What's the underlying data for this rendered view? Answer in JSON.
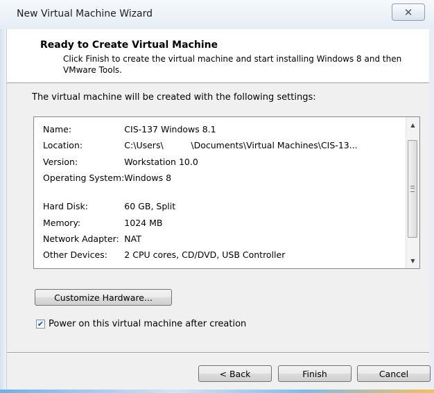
{
  "window": {
    "title": "New Virtual Machine Wizard",
    "close_glyph": "✕"
  },
  "header": {
    "title": "Ready to Create Virtual Machine",
    "subtitle": "Click Finish to create the virtual machine and start installing Windows 8 and then VMware Tools."
  },
  "intro_text": "The virtual machine will be created with the following settings:",
  "settings": [
    {
      "key": "Name:",
      "value": "CIS-137 Windows 8.1"
    },
    {
      "key": "Location:",
      "value": "C:\\Users\\          \\Documents\\Virtual Machines\\CIS-13..."
    },
    {
      "key": "Version:",
      "value": "Workstation 10.0"
    },
    {
      "key": "Operating System:",
      "value": "Windows 8"
    },
    {
      "key": "Hard Disk:",
      "value": "60 GB, Split"
    },
    {
      "key": "Memory:",
      "value": "1024 MB"
    },
    {
      "key": "Network Adapter:",
      "value": "NAT"
    },
    {
      "key": "Other Devices:",
      "value": "2 CPU cores, CD/DVD, USB Controller"
    }
  ],
  "scrollbar": {
    "up_arrow": "▲",
    "down_arrow": "▼"
  },
  "customize_button": "Customize Hardware...",
  "power_on": {
    "label": "Power on this virtual machine after creation",
    "checked": true,
    "check_glyph": "✔"
  },
  "buttons": {
    "back": "< Back",
    "finish": "Finish",
    "cancel": "Cancel"
  }
}
